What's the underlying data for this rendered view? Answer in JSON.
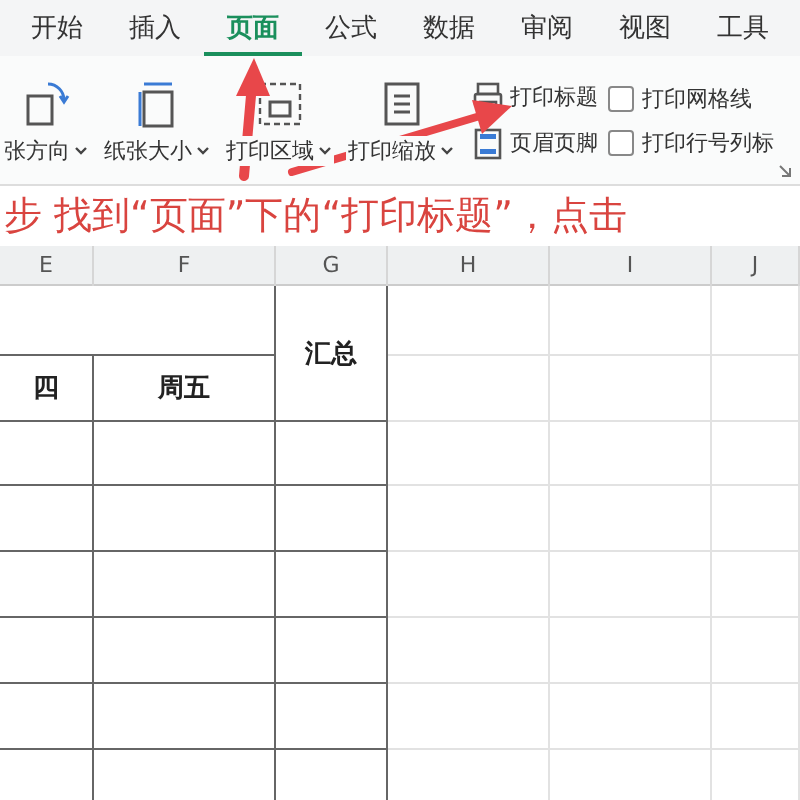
{
  "tabs": [
    {
      "label": "开始",
      "selected": false
    },
    {
      "label": "插入",
      "selected": false
    },
    {
      "label": "页面",
      "selected": true
    },
    {
      "label": "公式",
      "selected": false
    },
    {
      "label": "数据",
      "selected": false
    },
    {
      "label": "审阅",
      "selected": false
    },
    {
      "label": "视图",
      "selected": false
    },
    {
      "label": "工具",
      "selected": false
    }
  ],
  "ribbon": {
    "large_buttons": [
      {
        "label": "张方向",
        "kind": "orientation"
      },
      {
        "label": "纸张大小",
        "kind": "size"
      },
      {
        "label": "打印区域",
        "kind": "area"
      },
      {
        "label": "打印缩放",
        "kind": "scale"
      }
    ],
    "small_buttons": [
      {
        "label": "打印标题",
        "kind": "title"
      },
      {
        "label": "页眉页脚",
        "kind": "header"
      }
    ],
    "checkboxes": [
      {
        "label": "打印网格线",
        "checked": false
      },
      {
        "label": "打印行号列标",
        "checked": false
      }
    ]
  },
  "caption": "步 找到“页面”下的“打印标题”，点击",
  "table": {
    "columns": [
      "E",
      "F",
      "G",
      "H",
      "I",
      "J"
    ],
    "summary_header": "汇总",
    "day_headers": [
      "四",
      "周五"
    ]
  }
}
